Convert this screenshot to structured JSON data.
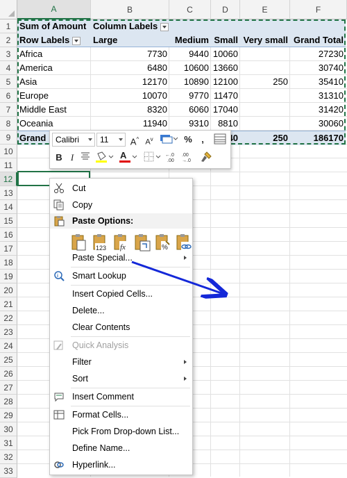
{
  "columns": [
    "A",
    "B",
    "C",
    "D",
    "E",
    "F"
  ],
  "rows": [
    "1",
    "2",
    "3",
    "4",
    "5",
    "6",
    "7",
    "8",
    "9",
    "10",
    "11",
    "12",
    "13",
    "14",
    "15",
    "16",
    "17",
    "18",
    "19",
    "20",
    "21",
    "22",
    "23",
    "24",
    "25",
    "26",
    "27",
    "28",
    "29",
    "30",
    "31",
    "32",
    "33"
  ],
  "pivot": {
    "sum_label": "Sum of Amount",
    "col_labels": "Column Labels",
    "row_labels": "Row Labels",
    "headers": [
      "Large",
      "Medium",
      "Small",
      "Very small",
      "Grand Total"
    ],
    "data": [
      {
        "region": "Africa",
        "large": "7730",
        "medium": "9440",
        "small": "10060",
        "very_small": "",
        "total": "27230"
      },
      {
        "region": "America",
        "large": "6480",
        "medium": "10600",
        "small": "13660",
        "very_small": "",
        "total": "30740"
      },
      {
        "region": "Asia",
        "large": "12170",
        "medium": "10890",
        "small": "12100",
        "very_small": "250",
        "total": "35410"
      },
      {
        "region": "Europe",
        "large": "10070",
        "medium": "9770",
        "small": "11470",
        "very_small": "",
        "total": "31310"
      },
      {
        "region": "Middle East",
        "large": "8320",
        "medium": "6060",
        "small": "17040",
        "very_small": "",
        "total": "31420"
      },
      {
        "region": "Oceania",
        "large": "11940",
        "medium": "9310",
        "small": "8810",
        "very_small": "",
        "total": "30060"
      }
    ],
    "grand_label": "Grand",
    "grand_small_partial": "40",
    "grand_very_small": "250",
    "grand_total": "186170"
  },
  "mini_toolbar": {
    "font": "Calibri",
    "size": "11",
    "grow": "A",
    "shrink": "A",
    "percent": "%",
    "comma": ",",
    "bold": "B",
    "italic": "I",
    "font_color": "A"
  },
  "menu": {
    "cut": "Cut",
    "copy": "Copy",
    "paste_options": "Paste Options:",
    "paste_special": "Paste Special...",
    "smart_lookup": "Smart Lookup",
    "insert_copied": "Insert Copied Cells...",
    "delete": "Delete...",
    "clear": "Clear Contents",
    "quick_analysis": "Quick Analysis",
    "filter": "Filter",
    "sort": "Sort",
    "insert_comment": "Insert Comment",
    "format_cells": "Format Cells...",
    "pick_list": "Pick From Drop-down List...",
    "define_name": "Define Name...",
    "hyperlink": "Hyperlink..."
  },
  "colors": {
    "accent": "#217346",
    "pivot_band": "#dce6f1",
    "arrow": "#1428d8"
  }
}
